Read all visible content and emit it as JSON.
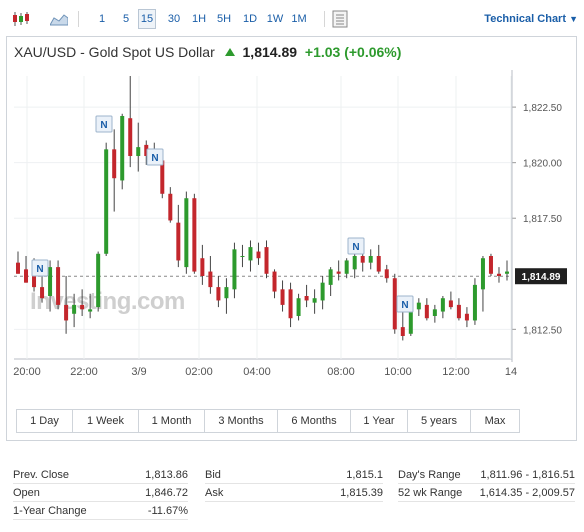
{
  "toolbar": {
    "chart_type_icon": "candlestick-icon",
    "area_icon": "area-chart-icon",
    "intervals": [
      "1",
      "5",
      "15",
      "30",
      "1H",
      "5H",
      "1D",
      "1W",
      "1M"
    ],
    "active_interval": "15",
    "settings_icon": "chart-settings-icon",
    "technical_link": "Technical Chart",
    "technical_icon": "chevron-down-icon"
  },
  "headline": {
    "instrument": "XAU/USD - Gold Spot US Dollar",
    "price": "1,814.89",
    "change": "+1.03 (+0.06%)"
  },
  "chart_data": {
    "type": "candlestick",
    "y_ticks": [
      "1,822.50",
      "1,820.00",
      "1,817.50",
      "1,812.50"
    ],
    "y_tick_values": [
      1822.5,
      1820.0,
      1817.5,
      1812.5
    ],
    "x_ticks": [
      "20:00",
      "22:00",
      "3/9",
      "02:00",
      "04:00",
      "08:00",
      "10:00",
      "12:00",
      "14"
    ],
    "last_price_label": "1,814.89",
    "last_price": 1814.89,
    "ylim": [
      1811.3,
      1823.9
    ],
    "grid": true,
    "watermark": "Investing.com",
    "news_markers": [
      "N",
      "N",
      "N",
      "N",
      "N"
    ],
    "candles": [
      {
        "o": 1815.5,
        "h": 1816.0,
        "l": 1815.0,
        "c": 1815.0
      },
      {
        "o": 1815.2,
        "h": 1815.8,
        "l": 1814.6,
        "c": 1814.6
      },
      {
        "o": 1815.0,
        "h": 1815.7,
        "l": 1814.2,
        "c": 1814.4
      },
      {
        "o": 1814.4,
        "h": 1815.2,
        "l": 1813.7,
        "c": 1813.9
      },
      {
        "o": 1814.0,
        "h": 1815.6,
        "l": 1813.3,
        "c": 1815.3
      },
      {
        "o": 1815.3,
        "h": 1815.6,
        "l": 1813.4,
        "c": 1813.6
      },
      {
        "o": 1813.6,
        "h": 1814.9,
        "l": 1812.3,
        "c": 1812.9
      },
      {
        "o": 1813.2,
        "h": 1814.1,
        "l": 1812.6,
        "c": 1813.6
      },
      {
        "o": 1813.6,
        "h": 1814.3,
        "l": 1813.1,
        "c": 1813.4
      },
      {
        "o": 1813.3,
        "h": 1814.1,
        "l": 1813.0,
        "c": 1813.4
      },
      {
        "o": 1813.5,
        "h": 1816.0,
        "l": 1813.3,
        "c": 1815.9
      },
      {
        "o": 1815.9,
        "h": 1820.9,
        "l": 1815.8,
        "c": 1820.6
      },
      {
        "o": 1820.6,
        "h": 1821.5,
        "l": 1817.8,
        "c": 1819.3
      },
      {
        "o": 1819.2,
        "h": 1822.2,
        "l": 1818.8,
        "c": 1822.1
      },
      {
        "o": 1822.0,
        "h": 1823.9,
        "l": 1819.8,
        "c": 1820.3
      },
      {
        "o": 1820.3,
        "h": 1821.8,
        "l": 1819.6,
        "c": 1820.7
      },
      {
        "o": 1820.8,
        "h": 1821.0,
        "l": 1819.9,
        "c": 1820.3
      },
      {
        "o": 1820.5,
        "h": 1820.9,
        "l": 1819.9,
        "c": 1820.0
      },
      {
        "o": 1820.1,
        "h": 1820.4,
        "l": 1818.4,
        "c": 1818.6
      },
      {
        "o": 1818.6,
        "h": 1818.9,
        "l": 1817.3,
        "c": 1817.4
      },
      {
        "o": 1817.3,
        "h": 1818.1,
        "l": 1815.3,
        "c": 1815.6
      },
      {
        "o": 1815.3,
        "h": 1818.7,
        "l": 1815.0,
        "c": 1818.4
      },
      {
        "o": 1818.4,
        "h": 1818.6,
        "l": 1815.0,
        "c": 1815.1
      },
      {
        "o": 1815.7,
        "h": 1816.3,
        "l": 1814.5,
        "c": 1814.9
      },
      {
        "o": 1815.1,
        "h": 1815.8,
        "l": 1814.1,
        "c": 1814.4
      },
      {
        "o": 1814.4,
        "h": 1814.9,
        "l": 1813.5,
        "c": 1813.8
      },
      {
        "o": 1813.9,
        "h": 1814.8,
        "l": 1813.2,
        "c": 1814.4
      },
      {
        "o": 1814.3,
        "h": 1816.4,
        "l": 1813.9,
        "c": 1816.1
      },
      {
        "o": 1815.8,
        "h": 1816.3,
        "l": 1815.3,
        "c": 1815.8
      },
      {
        "o": 1815.6,
        "h": 1816.5,
        "l": 1815.1,
        "c": 1816.2
      },
      {
        "o": 1816.0,
        "h": 1816.4,
        "l": 1815.4,
        "c": 1815.7
      },
      {
        "o": 1816.2,
        "h": 1816.5,
        "l": 1814.8,
        "c": 1815.0
      },
      {
        "o": 1815.1,
        "h": 1815.2,
        "l": 1813.9,
        "c": 1814.2
      },
      {
        "o": 1814.3,
        "h": 1814.7,
        "l": 1813.3,
        "c": 1813.6
      },
      {
        "o": 1814.3,
        "h": 1814.6,
        "l": 1812.6,
        "c": 1813.0
      },
      {
        "o": 1813.1,
        "h": 1814.1,
        "l": 1812.9,
        "c": 1813.9
      },
      {
        "o": 1814.0,
        "h": 1814.5,
        "l": 1813.5,
        "c": 1813.8
      },
      {
        "o": 1813.7,
        "h": 1814.3,
        "l": 1813.2,
        "c": 1813.9
      },
      {
        "o": 1813.8,
        "h": 1814.9,
        "l": 1813.4,
        "c": 1814.6
      },
      {
        "o": 1814.5,
        "h": 1815.3,
        "l": 1814.0,
        "c": 1815.2
      },
      {
        "o": 1815.1,
        "h": 1815.6,
        "l": 1814.7,
        "c": 1815.0
      },
      {
        "o": 1815.0,
        "h": 1815.7,
        "l": 1814.8,
        "c": 1815.6
      },
      {
        "o": 1815.2,
        "h": 1816.0,
        "l": 1814.8,
        "c": 1815.8
      },
      {
        "o": 1815.8,
        "h": 1816.2,
        "l": 1815.1,
        "c": 1815.5
      },
      {
        "o": 1815.5,
        "h": 1816.1,
        "l": 1815.2,
        "c": 1815.8
      },
      {
        "o": 1815.8,
        "h": 1816.3,
        "l": 1815.0,
        "c": 1815.1
      },
      {
        "o": 1815.2,
        "h": 1815.4,
        "l": 1814.6,
        "c": 1814.8
      },
      {
        "o": 1814.8,
        "h": 1815.0,
        "l": 1812.3,
        "c": 1812.5
      },
      {
        "o": 1812.6,
        "h": 1813.3,
        "l": 1812.0,
        "c": 1812.2
      },
      {
        "o": 1812.3,
        "h": 1813.7,
        "l": 1812.2,
        "c": 1813.5
      },
      {
        "o": 1813.4,
        "h": 1813.9,
        "l": 1813.1,
        "c": 1813.7
      },
      {
        "o": 1813.6,
        "h": 1813.9,
        "l": 1812.9,
        "c": 1813.0
      },
      {
        "o": 1813.1,
        "h": 1813.6,
        "l": 1812.8,
        "c": 1813.4
      },
      {
        "o": 1813.3,
        "h": 1814.0,
        "l": 1813.0,
        "c": 1813.9
      },
      {
        "o": 1813.8,
        "h": 1814.2,
        "l": 1813.4,
        "c": 1813.5
      },
      {
        "o": 1813.6,
        "h": 1813.9,
        "l": 1812.9,
        "c": 1813.0
      },
      {
        "o": 1813.2,
        "h": 1813.5,
        "l": 1812.6,
        "c": 1812.9
      },
      {
        "o": 1812.9,
        "h": 1814.8,
        "l": 1812.7,
        "c": 1814.5
      },
      {
        "o": 1814.3,
        "h": 1815.8,
        "l": 1813.3,
        "c": 1815.7
      },
      {
        "o": 1815.8,
        "h": 1815.9,
        "l": 1814.9,
        "c": 1815.0
      },
      {
        "o": 1815.0,
        "h": 1815.3,
        "l": 1814.6,
        "c": 1814.9
      },
      {
        "o": 1815.0,
        "h": 1815.6,
        "l": 1814.7,
        "c": 1815.1
      }
    ]
  },
  "ranges": [
    "1 Day",
    "1 Week",
    "1 Month",
    "3 Months",
    "6 Months",
    "1 Year",
    "5 years",
    "Max"
  ],
  "stats": [
    {
      "label": "Prev. Close",
      "value": "1,813.86"
    },
    {
      "label": "Open",
      "value": "1,846.72"
    },
    {
      "label": "1-Year Change",
      "value": "-11.67%"
    },
    {
      "label": "Bid",
      "value": "1,815.1"
    },
    {
      "label": "Ask",
      "value": "1,815.39"
    },
    {
      "label": "Day's Range",
      "value": "1,811.96 - 1,816.51"
    },
    {
      "label": "52 wk Range",
      "value": "1,614.35 - 2,009.57"
    }
  ],
  "colors": {
    "up": "#2d9a2d",
    "down": "#c3262c",
    "link": "#1a5ea8",
    "grid": "#eef0f2"
  }
}
